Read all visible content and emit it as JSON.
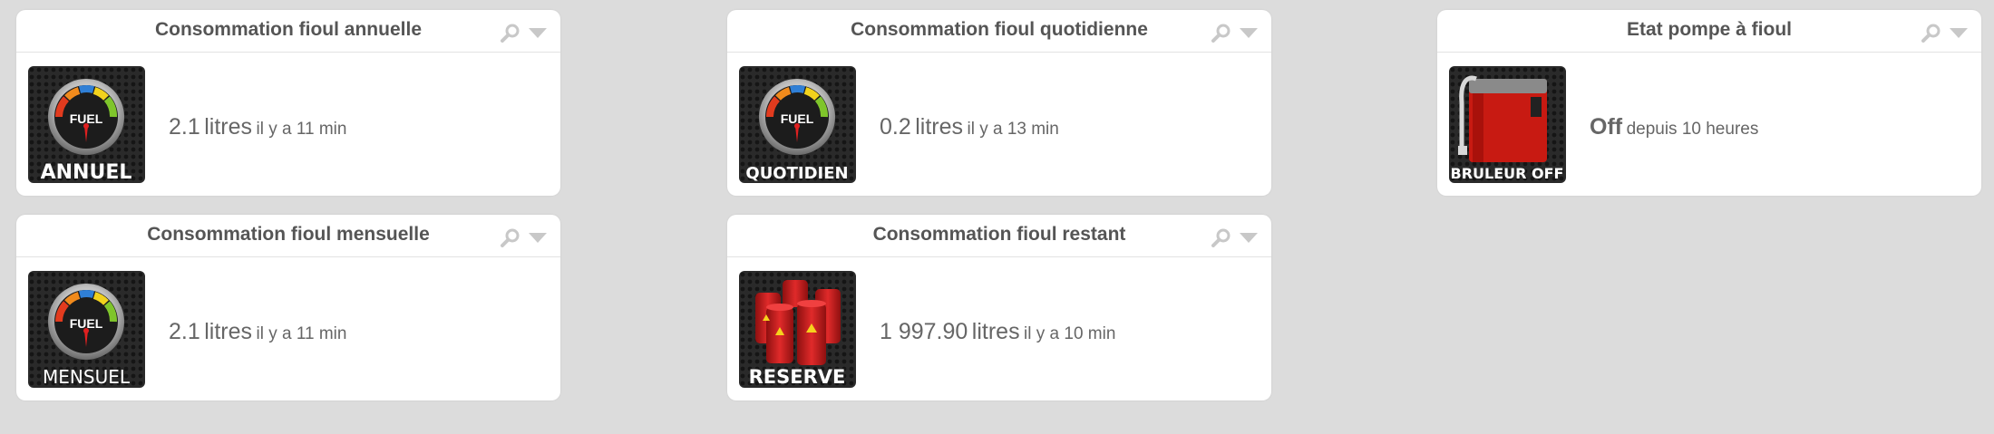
{
  "widgets": [
    {
      "title": "Consommation fioul annuelle",
      "value": "2.1",
      "unit": "litres",
      "time": "il y a 11 min",
      "tile_label": "ANNUEL",
      "tile_word": "FUEL",
      "icon": "fuel-gauge-icon"
    },
    {
      "title": "Consommation fioul quotidienne",
      "value": "0.2",
      "unit": "litres",
      "time": "il y a 13 min",
      "tile_label": "QUOTIDIEN",
      "tile_word": "FUEL",
      "icon": "fuel-gauge-icon"
    },
    {
      "title": "Etat pompe à fioul",
      "value": "Off",
      "unit": "",
      "time": "depuis 10 heures",
      "tile_label": "BRULEUR OFF",
      "icon": "boiler-icon"
    },
    {
      "title": "Consommation fioul mensuelle",
      "value": "2.1",
      "unit": "litres",
      "time": "il y a 11 min",
      "tile_label": "MENSUEL",
      "tile_word": "FUEL",
      "icon": "fuel-gauge-icon"
    },
    {
      "title": "Consommation fioul restant",
      "value": "1 997.90",
      "unit": "litres",
      "time": "il y a 10 min",
      "tile_label": "RESERVE",
      "icon": "fuel-barrels-icon"
    }
  ],
  "colors": {
    "background": "#dcdcdc",
    "card": "#ffffff",
    "title_text": "#555555",
    "value_text": "#666666",
    "tool_icons": "#c8c8c8",
    "barrel_red": "#d42020"
  }
}
